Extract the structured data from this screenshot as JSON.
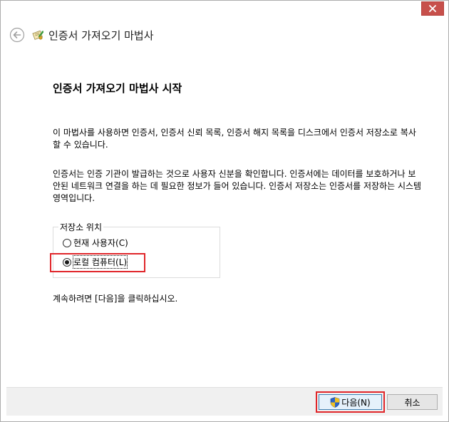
{
  "window": {
    "close_label": "✕"
  },
  "nav": {
    "title": "인증서 가져오기 마법사"
  },
  "page": {
    "heading": "인증서 가져오기 마법사 시작",
    "para1": "이 마법사를 사용하면 인증서, 인증서 신뢰 목록, 인증서 해지 목록을 디스크에서 인증서 저장소로 복사할 수 있습니다.",
    "para2": "인증서는 인증 기관이 발급하는 것으로 사용자 신분을 확인합니다. 인증서에는 데이터를 보호하거나 보안된 네트워크 연결을 하는 데 필요한 정보가 들어 있습니다. 인증서 저장소는 인증서를 저장하는 시스템 영역입니다.",
    "store_location": {
      "label": "저장소 위치",
      "options": [
        {
          "label": "현재 사용자",
          "mnemonic": "(C)",
          "checked": false
        },
        {
          "label": "로컬 컴퓨터",
          "mnemonic": "(L)",
          "checked": true
        }
      ]
    },
    "continue_text": "계속하려면 [다음]을 클릭하십시오."
  },
  "footer": {
    "next_label": "다음",
    "next_mnemonic": "(N)",
    "cancel_label": "취소"
  },
  "colors": {
    "highlight": "#e0262a",
    "close_button": "#c7504b",
    "footer_bg": "#f0f0f0"
  }
}
